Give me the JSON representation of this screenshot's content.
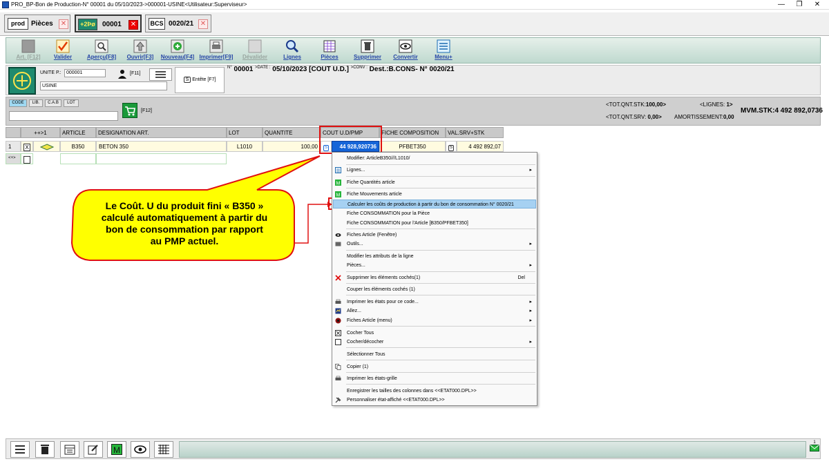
{
  "window": {
    "title": "PRO_BP-Bon de Production-N° 00001 du 05/10/2023->000001-USINE<Utilisateur:Superviseur>",
    "controls": {
      "minimize": "—",
      "maximize": "❐",
      "close": "✕"
    }
  },
  "tabs": [
    {
      "logo": "prod",
      "label": "Pièces",
      "close": "✕",
      "active": false
    },
    {
      "logo": "+2Þø",
      "label": "00001",
      "close": "✕",
      "active": true
    },
    {
      "logo": "BCS",
      "label": "0020/21",
      "close": "✕",
      "active": false
    }
  ],
  "toolbar": {
    "buttons": [
      {
        "label": "Art. [F12]",
        "icon": "article-icon",
        "disabled": true
      },
      {
        "label": "Valider",
        "icon": "check-icon",
        "disabled": false
      },
      {
        "label": "Aperçu[F8]",
        "icon": "preview-icon",
        "disabled": false
      },
      {
        "label": "Ouvrir[F3]",
        "icon": "open-icon",
        "disabled": false
      },
      {
        "label": "Nouveau[F4]",
        "icon": "new-icon",
        "disabled": false
      },
      {
        "label": "Imprimer[F9]",
        "icon": "print-icon",
        "disabled": false
      },
      {
        "label": "Dévalider",
        "icon": "unvalidate-icon",
        "disabled": true
      },
      {
        "label": "Lignes",
        "icon": "search-icon",
        "disabled": false
      },
      {
        "label": "Pièces",
        "icon": "grid-icon",
        "disabled": false
      },
      {
        "label": "Supprimer",
        "icon": "trash-icon",
        "disabled": false
      },
      {
        "label": "Convertir",
        "icon": "eye-icon",
        "disabled": false
      },
      {
        "label": "Menu+",
        "icon": "menu-icon",
        "disabled": false
      }
    ]
  },
  "header": {
    "unit_label": "UNITE P.:",
    "unit_value": "000001",
    "usine_value": "USINE",
    "user_shortcut": "[F11]",
    "entete_label": "Entête [F7]",
    "entete_icon_letter": "S",
    "n_prefix": "N°",
    "number": "00001",
    "date_prefix": ">DATE :",
    "date": "05/10/2023",
    "cout_label": "[COUT U.D.]",
    "conv_prefix": ">CONV :",
    "dest": "Dest.:B.CONS- N° 0020/21"
  },
  "filters": {
    "buttons": [
      "CODE",
      "LIB.",
      "C.A.B",
      "LOT"
    ],
    "active": "CODE",
    "cart_shortcut": "[F12]"
  },
  "stats": {
    "tot_qnt_stk_label": "<TOT.QNT.STK:",
    "tot_qnt_stk_value": "100,00>",
    "tot_qnt_srv_label": "<TOT.QNT.SRV:",
    "tot_qnt_srv_value": "0,00>",
    "lignes_label": "<LIGNES:",
    "lignes_value": "1>",
    "amortissement_label": "AMORTISSEMENT:",
    "amortissement_value": "0,00",
    "mvm_stk": "MVM.STK:4 492 892,0736"
  },
  "grid": {
    "columns": [
      "",
      "++>1",
      "ARTICLE",
      "DESIGNATION ART.",
      "LOT",
      "QUANTITE",
      "COUT U.D/PMP",
      "FICHE COMPOSITION",
      "VAL.SRV+STK"
    ],
    "rows": [
      {
        "num": "1",
        "check": "X",
        "article": "B350",
        "designation": "BETON 350",
        "lot": "L1010",
        "quantite": "100,00",
        "cout_icon": "S",
        "cout": "44 928,920736",
        "fiche": "PFBET350",
        "val_icon": "S",
        "val": "4 492 892,07"
      }
    ],
    "new_row_marker": "<+>"
  },
  "context_menu": {
    "items": [
      {
        "label": "Modifier: ArticleB350///L1010/",
        "icon": "none",
        "arrow": false
      },
      {
        "label": "Lignes...",
        "icon": "lines-icon",
        "arrow": true
      },
      {
        "label": "Fiche Quantités article",
        "icon": "m-icon",
        "arrow": false
      },
      {
        "label": "Fiche Mouvements article",
        "icon": "m-icon",
        "arrow": false
      },
      {
        "label": "Calculer les coûts de production à partir du bon de consommation N° 0020/21",
        "icon": "none",
        "arrow": false,
        "highlight": true
      },
      {
        "label": "Fiche CONSOMMATION pour la Pièce",
        "icon": "none",
        "arrow": false
      },
      {
        "label": "Fiche CONSOMMATION pour l'Article [B350/PFBET350]",
        "icon": "none",
        "arrow": false
      },
      {
        "label": "Fiches Article (Fenêtre)",
        "icon": "eye-icon",
        "arrow": false
      },
      {
        "label": "Outils...",
        "icon": "tools-icon",
        "arrow": true
      },
      {
        "label": "Modifier les attributs de la ligne",
        "icon": "none",
        "arrow": false
      },
      {
        "label": "Pièces...",
        "icon": "none",
        "arrow": true
      },
      {
        "label": "Supprimer les éléments cochés(1)",
        "icon": "delete-icon",
        "arrow": false,
        "shortcut": "Del"
      },
      {
        "label": "Couper les éléments cochés (1)",
        "icon": "none",
        "arrow": false
      },
      {
        "label": "Imprimer les états pour ce code...",
        "icon": "print-icon",
        "arrow": true
      },
      {
        "label": "Allez...",
        "icon": "goto-icon",
        "arrow": true
      },
      {
        "label": "Fiches Article (menu)",
        "icon": "eye-icon",
        "arrow": true
      },
      {
        "label": "Cocher Tous",
        "icon": "checkbox-icon",
        "arrow": false
      },
      {
        "label": "Cocher/décocher",
        "icon": "checkbox-empty-icon",
        "arrow": true
      },
      {
        "label": "Sélectionner Tous",
        "icon": "none",
        "arrow": false
      },
      {
        "label": "Copier (1)",
        "icon": "copy-icon",
        "arrow": false
      },
      {
        "label": "Imprimer les états-grille",
        "icon": "print-icon",
        "arrow": false
      },
      {
        "label": "Enregistrer les tailles des colonnes dans <<ETAT000.DPL>>",
        "icon": "none",
        "arrow": false
      },
      {
        "label": "Personnaliser état-affiché <<ETAT000.DPL>>",
        "icon": "wrench-icon",
        "arrow": false
      }
    ]
  },
  "callout": {
    "lines": [
      "Le Coût. U du produit fini « B350 »",
      "calculé automatiquement à partir du",
      "bon de consommation par rapport",
      "au PMP actuel."
    ],
    "fill": "#ffff00",
    "border": "#e01010"
  },
  "bottombar": {
    "buttons": [
      "menu-icon",
      "trash-icon",
      "calendar-icon",
      "edit-icon",
      "m-icon",
      "eye-icon",
      "grid-icon"
    ],
    "mail_count": "1"
  }
}
